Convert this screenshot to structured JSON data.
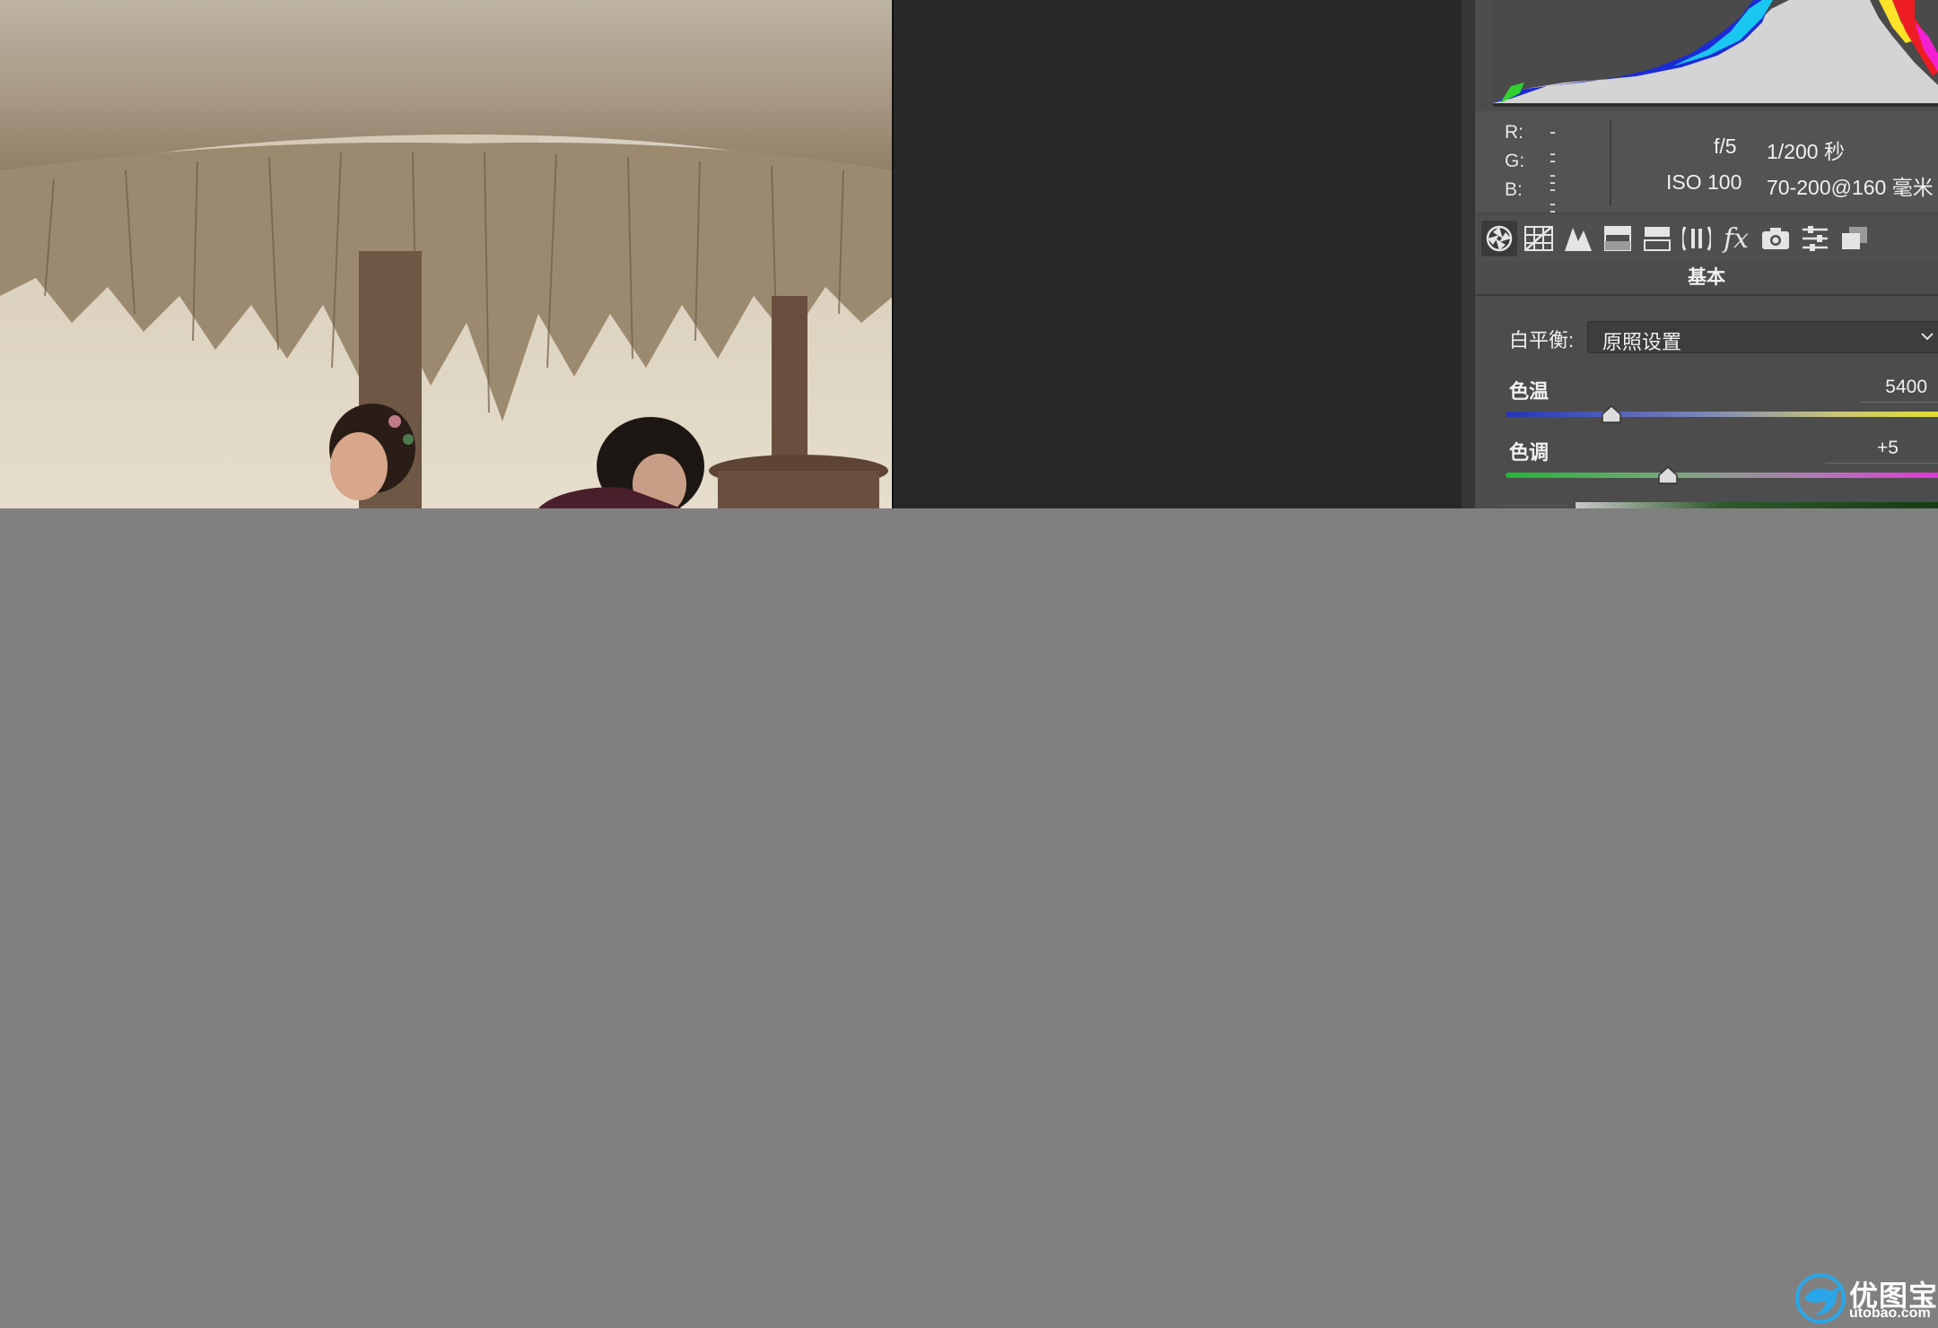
{
  "image": {
    "description_name": "beach-couple-photo"
  },
  "rgb_readout": {
    "r_label": "R:",
    "r_value": "---",
    "g_label": "G:",
    "g_value": "---",
    "b_label": "B:",
    "b_value": "---"
  },
  "exif": {
    "aperture": "f/5",
    "shutter": "1/200 秒",
    "iso": "ISO 100",
    "lens": "70-200@160 毫米"
  },
  "toolbar": {
    "tools": [
      "basic-icon",
      "tone-curve-icon",
      "detail-icon",
      "hsl-icon",
      "split-toning-icon",
      "lens-corrections-icon",
      "effects-icon",
      "camera-calibration-icon",
      "presets-icon",
      "snapshots-icon"
    ],
    "active": "basic-icon"
  },
  "panel": {
    "section_title": "基本",
    "white_balance_label": "白平衡:",
    "white_balance_value": "原照设置",
    "temperature_label": "色温",
    "temperature_value": "5400",
    "tint_label": "色调",
    "tint_value": "+5"
  },
  "sliders": {
    "temperature_position": 0.24,
    "tint_position": 0.37
  },
  "watermark": {
    "cn": "优图宝",
    "en": "utobao.com"
  },
  "colors": {
    "workspace_bg": "#808080",
    "panel_bg": "#4c4c4c",
    "canvas_bg": "#282828"
  }
}
